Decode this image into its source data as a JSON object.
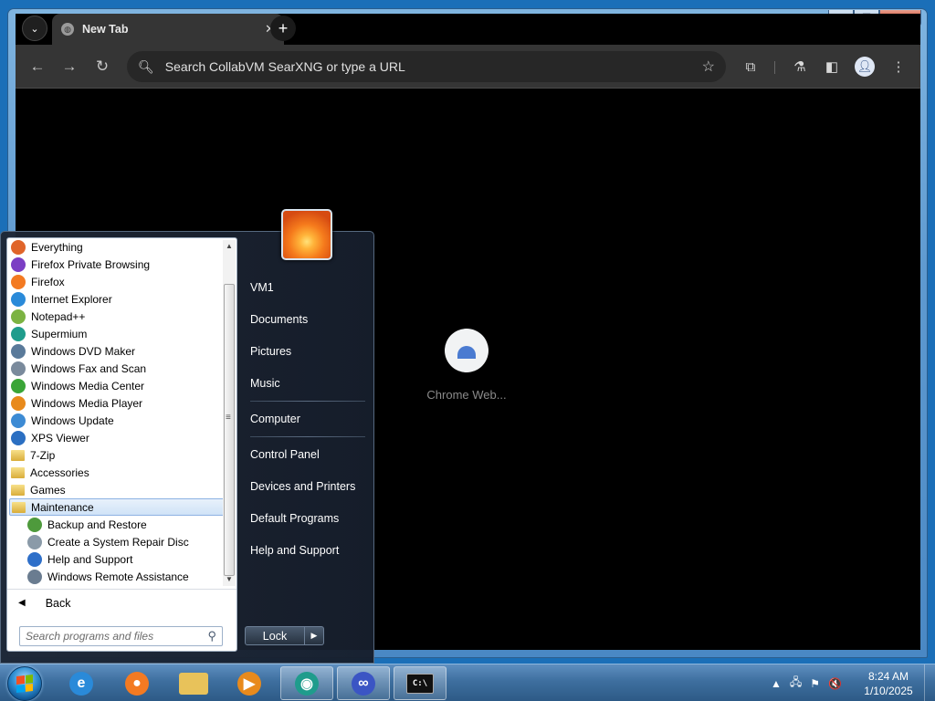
{
  "window": {
    "caption": {
      "minimize": "‒",
      "maximize": "☐",
      "close": "✕"
    }
  },
  "browser": {
    "tab_search_icon": "chevron-down-icon",
    "tab": {
      "title": "New Tab",
      "close": "✕"
    },
    "new_tab": "+",
    "omnibox_placeholder": "Search CollabVM SearXNG or type a URL",
    "shortcut": {
      "label": "Chrome Web..."
    }
  },
  "start_menu": {
    "programs": [
      {
        "label": "Everything",
        "icon": "everything-icon",
        "color": "#e0652a"
      },
      {
        "label": "Firefox Private Browsing",
        "icon": "firefox-private-icon",
        "color": "#7b3fc4"
      },
      {
        "label": "Firefox",
        "icon": "firefox-icon",
        "color": "#f37a22"
      },
      {
        "label": "Internet Explorer",
        "icon": "internet-explorer-icon",
        "color": "#2a8ad9"
      },
      {
        "label": "Notepad++",
        "icon": "notepadpp-icon",
        "color": "#7cb342"
      },
      {
        "label": "Supermium",
        "icon": "supermium-icon",
        "color": "#1f9c8c"
      },
      {
        "label": "Windows DVD Maker",
        "icon": "dvd-maker-icon",
        "color": "#5a7a9a"
      },
      {
        "label": "Windows Fax and Scan",
        "icon": "fax-scan-icon",
        "color": "#7a8a9c"
      },
      {
        "label": "Windows Media Center",
        "icon": "media-center-icon",
        "color": "#3aa537"
      },
      {
        "label": "Windows Media Player",
        "icon": "media-player-icon",
        "color": "#e88a1c"
      },
      {
        "label": "Windows Update",
        "icon": "windows-update-icon",
        "color": "#3d8bd4"
      },
      {
        "label": "XPS Viewer",
        "icon": "xps-viewer-icon",
        "color": "#2b6fc2"
      },
      {
        "label": "7-Zip",
        "icon": "folder-icon",
        "color": "folder"
      },
      {
        "label": "Accessories",
        "icon": "folder-icon",
        "color": "folder"
      },
      {
        "label": "Games",
        "icon": "folder-icon",
        "color": "folder"
      },
      {
        "label": "Maintenance",
        "icon": "folder-icon",
        "color": "folder",
        "selected": true
      },
      {
        "label": "Backup and Restore",
        "icon": "backup-restore-icon",
        "color": "#4e9a3c",
        "sub": true
      },
      {
        "label": "Create a System Repair Disc",
        "icon": "repair-disc-icon",
        "color": "#8a9aa8",
        "sub": true
      },
      {
        "label": "Help and Support",
        "icon": "help-support-icon",
        "color": "#2e6fc9",
        "sub": true
      },
      {
        "label": "Windows Remote Assistance",
        "icon": "remote-assistance-icon",
        "color": "#6a7c90",
        "sub": true
      }
    ],
    "back_label": "Back",
    "search_placeholder": "Search programs and files",
    "right_items": [
      {
        "label": "VM1",
        "sep_after": false
      },
      {
        "label": "Documents",
        "sep_after": false
      },
      {
        "label": "Pictures",
        "sep_after": false
      },
      {
        "label": "Music",
        "sep_after": true
      },
      {
        "label": "Computer",
        "sep_after": true
      },
      {
        "label": "Control Panel",
        "sep_after": false
      },
      {
        "label": "Devices and Printers",
        "sep_after": false
      },
      {
        "label": "Default Programs",
        "sep_after": false
      },
      {
        "label": "Help and Support",
        "sep_after": false
      }
    ],
    "lock_label": "Lock",
    "lock_arrow": "▶"
  },
  "taskbar": {
    "pinned": [
      {
        "name": "internet-explorer",
        "icon": "internet-explorer-icon",
        "glyph": "e",
        "color": "#2a8ad9",
        "active": false
      },
      {
        "name": "firefox",
        "icon": "firefox-icon",
        "glyph": "●",
        "color": "#f37a22",
        "active": false
      },
      {
        "name": "explorer",
        "icon": "folder-icon",
        "glyph": "",
        "color": "#e8c25a",
        "active": false
      },
      {
        "name": "media-player",
        "icon": "media-player-icon",
        "glyph": "▶",
        "color": "#e88a1c",
        "active": false
      },
      {
        "name": "supermium",
        "icon": "supermium-icon",
        "glyph": "◉",
        "color": "#1f9c8c",
        "active": true
      },
      {
        "name": "infinity-app",
        "icon": "infinity-icon",
        "glyph": "∞",
        "color": "#3b55c4",
        "active": true
      },
      {
        "name": "command-prompt",
        "icon": "command-prompt-icon",
        "glyph": "C:\\",
        "color": "#111111",
        "active": true
      }
    ],
    "tray": {
      "expand": "▲",
      "network": "🖧",
      "flag": "⚑",
      "volume": "🔇"
    },
    "time": "8:24 AM",
    "date": "1/10/2025"
  }
}
